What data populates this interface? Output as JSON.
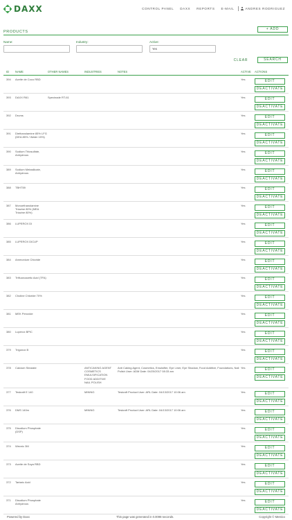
{
  "brand": {
    "name": "DAXX",
    "accent": "#3aa04a"
  },
  "nav": {
    "items": [
      "CONTROL PANEL",
      "DAXX",
      "REPORTS",
      "E-MAIL"
    ],
    "user": "ANDRES RODRIGUEZ"
  },
  "page": {
    "title": "PRODUCTS",
    "add_label": "+ ADD"
  },
  "filters": {
    "name_label": "Name:",
    "name_value": "",
    "industry_label": "Industry:",
    "industry_value": "",
    "active_label": "Active:",
    "active_value": "Yes",
    "clear_label": "CLEAR",
    "search_label": "SEARCH"
  },
  "table": {
    "headers": [
      "ID",
      "NAME",
      "OTHER NAMES",
      "INDUSTRIES",
      "NOTES",
      "ACTIVE",
      "ACTIONS"
    ],
    "edit_label": "EDIT",
    "deactivate_label": "DEACTIVATE",
    "rows": [
      {
        "id": "394",
        "name": "Aceite de Coco RBD",
        "other": "",
        "industries": "",
        "notes": "",
        "active": "Yes"
      },
      {
        "id": "393",
        "name": "DAXX R61",
        "other": "Specinade RT-61",
        "industries": "",
        "notes": "",
        "active": "Yes"
      },
      {
        "id": "392",
        "name": "Drums",
        "other": "",
        "industries": "",
        "notes": "",
        "active": "Yes"
      },
      {
        "id": "391",
        "name": "Diethanolamine 85% LFG (DEA 85% / Water 15%)",
        "other": "",
        "industries": "",
        "notes": "",
        "active": "Yes"
      },
      {
        "id": "390",
        "name": "Sodium Thiosulfate, Anhydrous",
        "other": "",
        "industries": "",
        "notes": "",
        "active": "Yes"
      },
      {
        "id": "389",
        "name": "Sodium Metasilicate, Anhydrous",
        "other": "",
        "industries": "",
        "notes": "",
        "active": "Yes"
      },
      {
        "id": "388",
        "name": "TBHT59",
        "other": "",
        "industries": "",
        "notes": "",
        "active": "Yes"
      },
      {
        "id": "387",
        "name": "Monoethanolamine Triazine 80% (MEA Triazine 80%)",
        "other": "",
        "industries": "",
        "notes": "",
        "active": "Yes"
      },
      {
        "id": "386",
        "name": "LUPEROX DI",
        "other": "",
        "industries": "",
        "notes": "",
        "active": "Yes"
      },
      {
        "id": "385",
        "name": "LUPEROX DICUP",
        "other": "",
        "industries": "",
        "notes": "",
        "active": "Yes"
      },
      {
        "id": "384",
        "name": "Ammonium Chloride",
        "other": "",
        "industries": "",
        "notes": "",
        "active": "Yes"
      },
      {
        "id": "383",
        "name": "Trifluoroacetic Acid (TFA)",
        "other": "",
        "industries": "",
        "notes": "",
        "active": "Yes"
      },
      {
        "id": "382",
        "name": "Choline Chloride 70%",
        "other": "",
        "industries": "",
        "notes": "",
        "active": "Yes"
      },
      {
        "id": "381",
        "name": "MEK Peroxide",
        "other": "",
        "industries": "",
        "notes": "",
        "active": "Yes"
      },
      {
        "id": "380",
        "name": "Luperox BPIC",
        "other": "",
        "industries": "",
        "notes": "",
        "active": "Yes"
      },
      {
        "id": "379",
        "name": "Trigonox B",
        "other": "",
        "industries": "",
        "notes": "",
        "active": "Yes"
      },
      {
        "id": "378",
        "name": "Calcium Stearate",
        "other": "",
        "industries": "ANTICAKING AGENT\nCOSMETICS\nEMULSIFICATION\nFOOD ADDITIVE\nNAIL POLISH",
        "notes": "Anti Caking Agent, Cosmetics, Emulsifier, Eye Liner, Eye Shadow, Food Additive, Foundations, Nail Polish User: ADM Date: 04/20/2017 08:33 am",
        "active": "Yes"
      },
      {
        "id": "377",
        "name": "Teskraft E 140",
        "other": "",
        "industries": "MINING",
        "notes": "Teskraft Product User: ARL Date: 04/13/2017 10:06 am",
        "active": "Yes"
      },
      {
        "id": "376",
        "name": "DMS 140m",
        "other": "",
        "industries": "MINING",
        "notes": "Teskraft Product User: ARL Date: 04/13/2017 10:06 am",
        "active": "Yes"
      },
      {
        "id": "375",
        "name": "Disodium Phosphate (DSP)",
        "other": "",
        "industries": "",
        "notes": "",
        "active": "Yes"
      },
      {
        "id": "374",
        "name": "Wecnic 3M",
        "other": "",
        "industries": "",
        "notes": "",
        "active": "Yes"
      },
      {
        "id": "373",
        "name": "Aceite de Soya RBD",
        "other": "",
        "industries": "",
        "notes": "",
        "active": "Yes"
      },
      {
        "id": "372",
        "name": "Tartaric Acid",
        "other": "",
        "industries": "",
        "notes": "",
        "active": "Yes"
      },
      {
        "id": "371",
        "name": "Disodium Phosphate Anhydrous",
        "other": "",
        "industries": "",
        "notes": "",
        "active": "Yes"
      }
    ]
  },
  "footer": {
    "powered": "Powered by Daxx",
    "generated": "This page was generated in 0.0098 seconds.",
    "copyright": "Copyright © Mestico"
  }
}
